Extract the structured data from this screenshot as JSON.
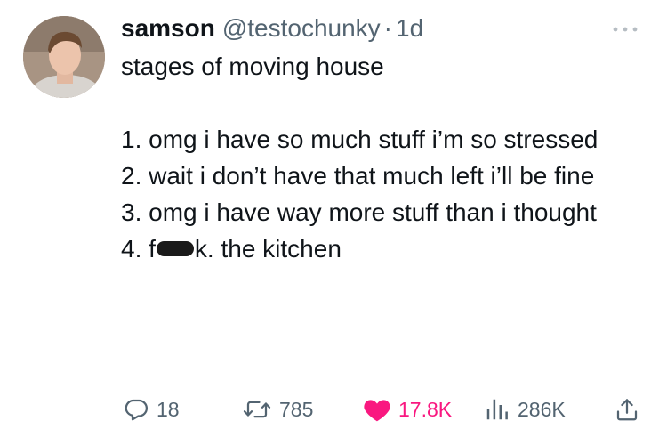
{
  "tweet": {
    "author": {
      "name": "samson",
      "handle": "@testochunky",
      "separator": "·",
      "time": "1d"
    },
    "text": {
      "title": "stages of moving house",
      "line1": "1. omg i have so much stuff i’m so stressed",
      "line2": "2. wait i don’t have that much left i’ll be fine",
      "line3": "3. omg i have way more stuff than i thought",
      "line4_before": "4. f",
      "line4_after": "k. the kitchen"
    },
    "metrics": {
      "replies": "18",
      "retweets": "785",
      "likes": "17.8K",
      "views": "286K"
    }
  },
  "colors": {
    "text": "#0f1419",
    "secondary": "#536471",
    "like": "#f91880"
  },
  "icons": {
    "more": "more-icon",
    "reply": "reply-icon",
    "retweet": "retweet-icon",
    "like": "heart-icon",
    "views": "views-icon",
    "share": "share-icon"
  }
}
